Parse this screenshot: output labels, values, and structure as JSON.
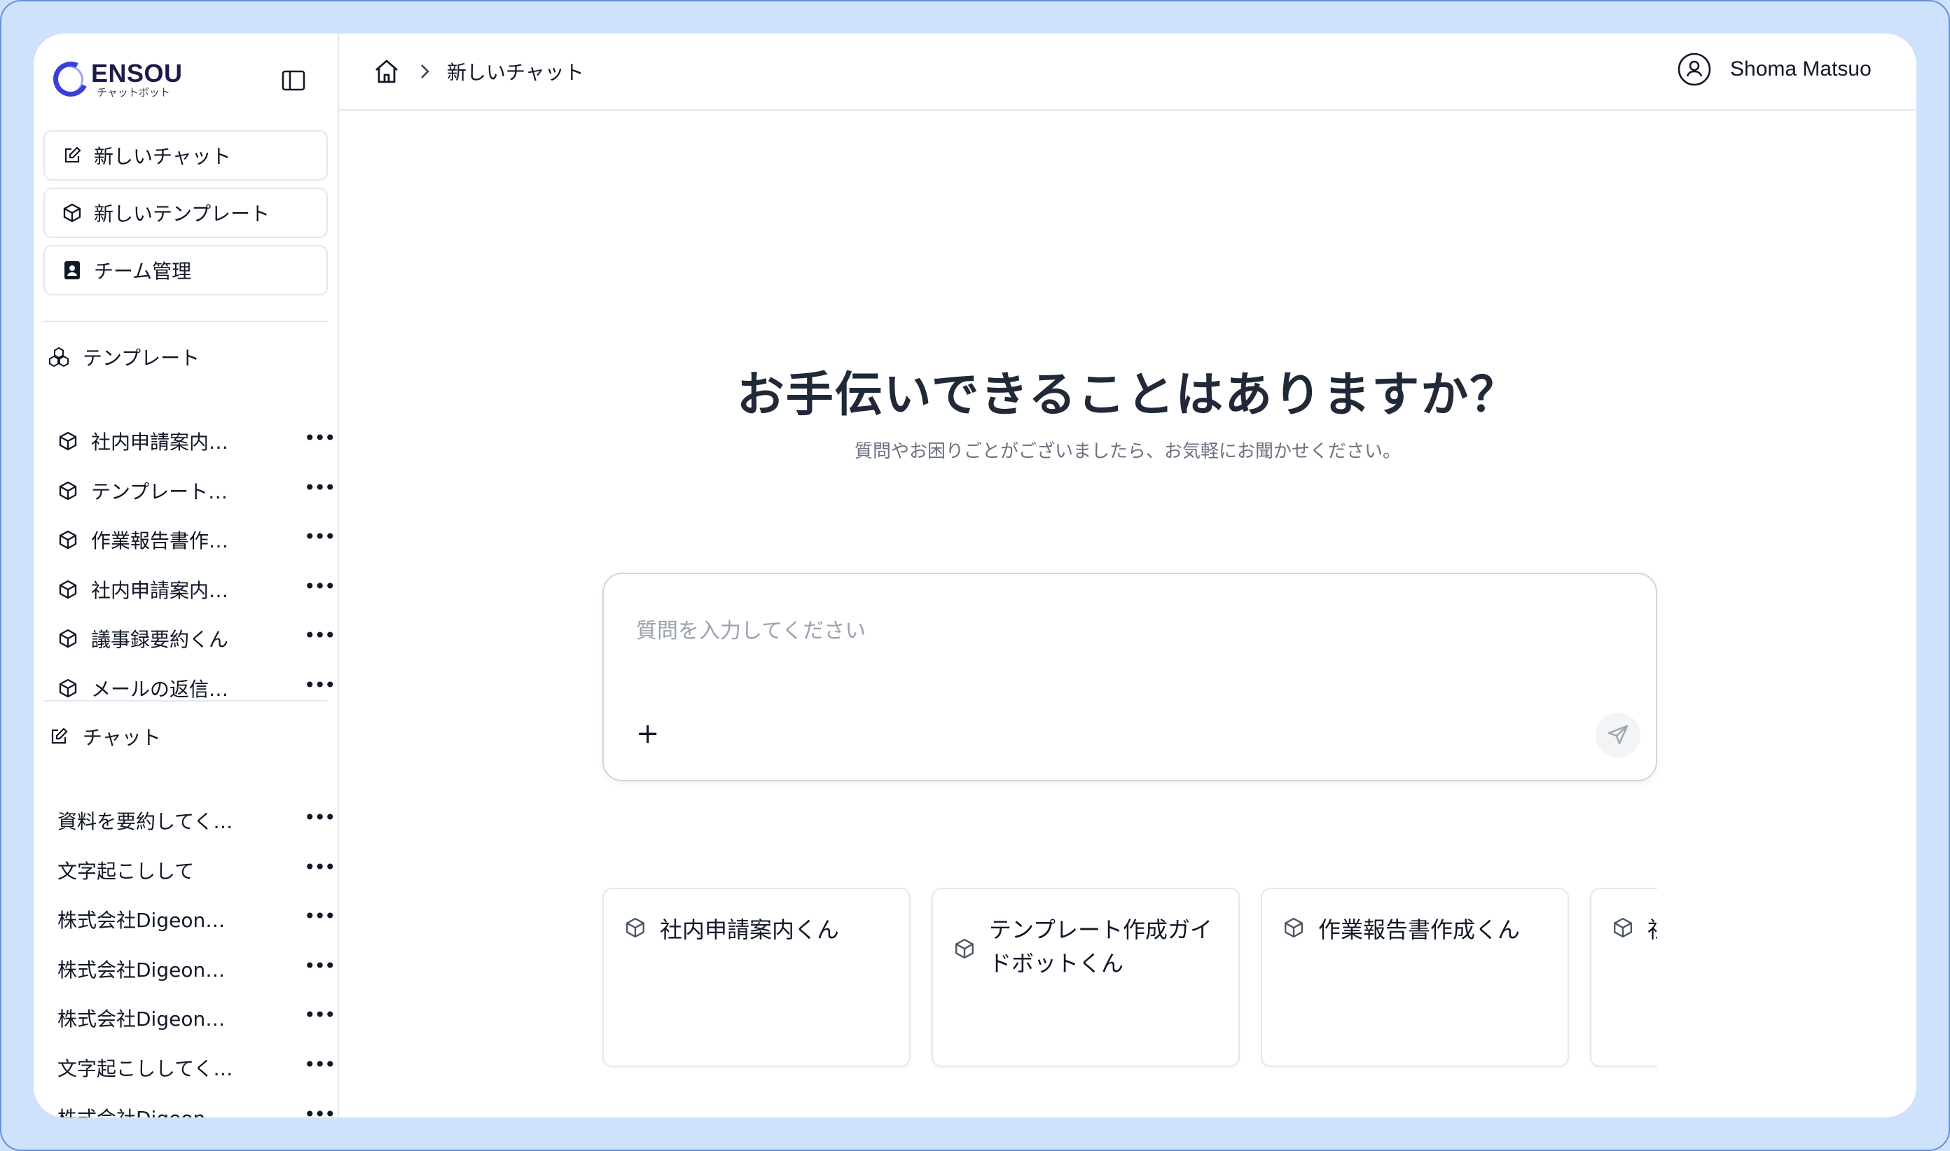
{
  "app": {
    "brand": "ENSOU",
    "brand_sub": "チャットボット"
  },
  "sidebar": {
    "actions": [
      {
        "label": "新しいチャット",
        "icon": "edit-icon"
      },
      {
        "label": "新しいテンプレート",
        "icon": "cube-icon"
      },
      {
        "label": "チーム管理",
        "icon": "contact-icon"
      }
    ],
    "templates_heading": "テンプレート",
    "templates": [
      {
        "label": "社内申請案内…"
      },
      {
        "label": "テンプレート…"
      },
      {
        "label": "作業報告書作…"
      },
      {
        "label": "社内申請案内…"
      },
      {
        "label": "議事録要約くん"
      },
      {
        "label": "メールの返信…"
      }
    ],
    "chats_heading": "チャット",
    "chats": [
      {
        "label": "資料を要約してく…"
      },
      {
        "label": "文字起こしして"
      },
      {
        "label": "株式会社Digeon…"
      },
      {
        "label": "株式会社Digeon…"
      },
      {
        "label": "株式会社Digeon…"
      },
      {
        "label": "文字起こししてく…"
      },
      {
        "label": "株式会社Digeon…"
      }
    ],
    "more_label": "•••"
  },
  "header": {
    "breadcrumb_current": "新しいチャット",
    "user_name": "Shoma Matsuo"
  },
  "main": {
    "title": "お手伝いできることはありますか？",
    "subtitle": "質問やお困りごとがございましたら、お気軽にお聞かせください。",
    "input_placeholder": "質問を入力してください",
    "input_value": "",
    "plus_label": "+"
  },
  "cards": [
    {
      "title": "社内申請案内くん"
    },
    {
      "title": "テンプレート作成ガイドボットくん"
    },
    {
      "title": "作業報告書作成くん"
    },
    {
      "title": "社内申請案内くん"
    }
  ],
  "colors": {
    "background": "#cfe2fb",
    "brand": "#3b3fd8",
    "text": "#1f2937",
    "muted": "#6b7280",
    "border": "#e5e7eb"
  }
}
